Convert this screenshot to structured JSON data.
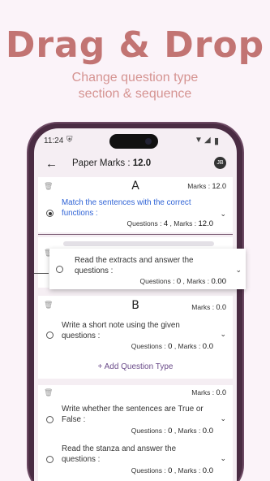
{
  "promo": {
    "title": "Drag & Drop",
    "subtitle_line1": "Change question type",
    "subtitle_line2": "section & sequence"
  },
  "status_bar": {
    "time": "11:24",
    "icons": [
      "shield-icon",
      "wifi-icon",
      "signal-icon",
      "battery-icon"
    ]
  },
  "app_bar": {
    "label": "Paper Marks :",
    "value": "12.0",
    "avatar_text": "JB"
  },
  "sections": [
    {
      "letter": "A",
      "marks_label": "Marks :",
      "marks_value": "12.0",
      "questions": [
        {
          "text": "Match the sentences with the correct functions :",
          "selected": true,
          "questions_label": "Questions :",
          "questions_value": "4",
          "marks_label": ", Marks :",
          "marks_value": "12.0"
        }
      ]
    },
    {
      "letter": "B",
      "marks_label": "Marks :",
      "marks_value": "0.0",
      "questions": [
        {
          "text": "Write a short note using the given questions :",
          "selected": false,
          "questions_label": "Questions :",
          "questions_value": "0",
          "marks_label": ", Marks :",
          "marks_value": "0.0"
        }
      ],
      "add_label": "+ Add Question Type"
    },
    {
      "letter": "",
      "marks_label": "Marks :",
      "marks_value": "0.0",
      "questions": [
        {
          "text": "Write whether the sentences are True or False :",
          "selected": false,
          "questions_label": "Questions :",
          "questions_value": "0",
          "marks_label": ", Marks :",
          "marks_value": "0.0"
        },
        {
          "text": "Read the stanza and answer the questions :",
          "selected": false,
          "questions_label": "Questions :",
          "questions_value": "0",
          "marks_label": ", Marks :",
          "marks_value": "0.0"
        }
      ]
    }
  ],
  "dragging": {
    "text": "Read the extracts and answer the questions :",
    "questions_label": "Questions :",
    "questions_value": "0",
    "marks_label": ", Marks :",
    "marks_value": "0.00"
  }
}
